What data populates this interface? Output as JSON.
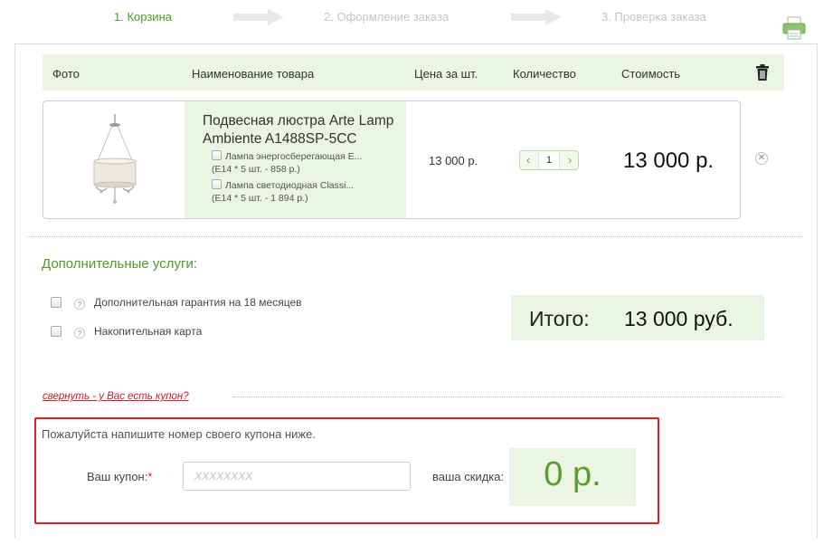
{
  "steps": [
    {
      "label": "1. Корзина",
      "state": "active"
    },
    {
      "label": "2. Оформление заказа",
      "state": "inactive"
    },
    {
      "label": "3. Проверка заказа",
      "state": "inactive"
    }
  ],
  "colors": {
    "accent_green": "#4f9a2b",
    "light_green_bg": "#eaf5e3",
    "alert_red": "#e01f26"
  },
  "table": {
    "headers": {
      "photo": "Фото",
      "name": "Наименование товара",
      "unit_price": "Цена за шт.",
      "quantity": "Количество",
      "cost": "Стоимость"
    }
  },
  "product": {
    "name": "Подвесная люстра Arte Lamp Ambiente A1488SP-5CC",
    "options": [
      {
        "line1": "Лампа энергосберегающая Е...",
        "line2": "(E14 * 5 шт. - 858 р.)"
      },
      {
        "line1": "Лампа светодиодная Classi...",
        "line2": "(E14 * 5 шт. - 1 894 р.)"
      }
    ],
    "unit_price": "13 000 р.",
    "quantity": "1",
    "cost": "13 000 р."
  },
  "services": {
    "title": "Дополнительные услуги:",
    "items": [
      {
        "label": "Дополнительная гарантия на 18 месяцев"
      },
      {
        "label": "Накопительная карта"
      }
    ]
  },
  "total": {
    "label": "Итого:",
    "value": "13 000 руб."
  },
  "coupon": {
    "toggle_link": "свернуть - у Вас есть купон?",
    "instruction": "Пожалуйста напишите номер своего купона ниже.",
    "label": "Ваш купон:",
    "required_mark": "*",
    "placeholder": "XXXXXXXX",
    "discount_label": "ваша скидка:",
    "discount_value": "0 р."
  }
}
